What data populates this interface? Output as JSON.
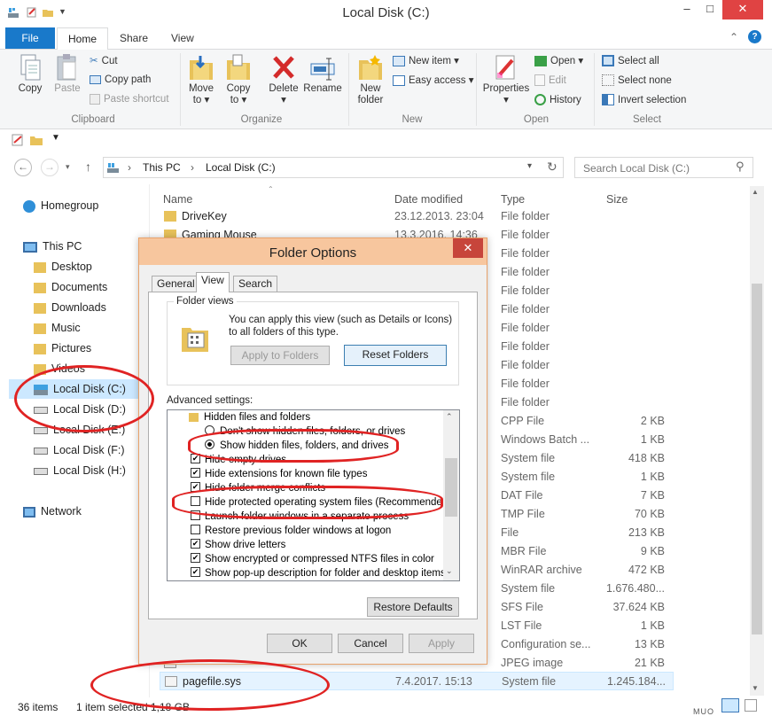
{
  "window": {
    "title": "Local Disk (C:)",
    "min": "‒",
    "max": "□",
    "close": "✕"
  },
  "ribbon": {
    "tabs": [
      "File",
      "Home",
      "Share",
      "View"
    ],
    "clipboard": {
      "label": "Clipboard",
      "copy": "Copy",
      "paste": "Paste",
      "cut": "Cut",
      "copy_path": "Copy path",
      "paste_shortcut": "Paste shortcut"
    },
    "organize": {
      "label": "Organize",
      "move_to": "Move",
      "move_to2": "to ▾",
      "copy_to": "Copy",
      "copy_to2": "to ▾",
      "delete": "Delete",
      "delete2": "▾",
      "rename": "Rename"
    },
    "new": {
      "label": "New",
      "new_folder": "New",
      "new_folder2": "folder",
      "new_item": "New item ▾",
      "easy_access": "Easy access ▾"
    },
    "open": {
      "label": "Open",
      "properties": "Properties",
      "properties2": "▾",
      "open": "Open ▾",
      "edit": "Edit",
      "history": "History"
    },
    "select": {
      "label": "Select",
      "select_all": "Select all",
      "select_none": "Select none",
      "invert": "Invert selection"
    }
  },
  "address": {
    "this_pc": "This PC",
    "drive": "Local Disk (C:)",
    "search_placeholder": "Search Local Disk (C:)"
  },
  "nav": {
    "homegroup": "Homegroup",
    "this_pc": "This PC",
    "desktop": "Desktop",
    "documents": "Documents",
    "downloads": "Downloads",
    "music": "Music",
    "pictures": "Pictures",
    "videos": "Videos",
    "drive_c": "Local Disk (C:)",
    "drive_d": "Local Disk (D:)",
    "drive_e": "Local Disk (E:)",
    "drive_f": "Local Disk (F:)",
    "drive_h": "Local Disk (H:)",
    "network": "Network"
  },
  "columns": {
    "name": "Name",
    "date": "Date modified",
    "type": "Type",
    "size": "Size"
  },
  "files": [
    {
      "name": "DriveKey",
      "date": "23.12.2013. 23:04",
      "type": "File folder",
      "size": ""
    },
    {
      "name": "Gaming Mouse",
      "date": "13.3.2016. 14:36",
      "type": "File folder",
      "size": ""
    },
    {
      "name": "",
      "date": "",
      "type": "File folder",
      "size": ""
    },
    {
      "name": "",
      "date": "",
      "type": "File folder",
      "size": ""
    },
    {
      "name": "",
      "date": "",
      "type": "File folder",
      "size": ""
    },
    {
      "name": "",
      "date": "",
      "type": "File folder",
      "size": ""
    },
    {
      "name": "",
      "date": "",
      "type": "File folder",
      "size": ""
    },
    {
      "name": "",
      "date": "",
      "type": "File folder",
      "size": ""
    },
    {
      "name": "",
      "date": "",
      "type": "File folder",
      "size": ""
    },
    {
      "name": "",
      "date": "",
      "type": "File folder",
      "size": ""
    },
    {
      "name": "",
      "date": "",
      "type": "File folder",
      "size": ""
    },
    {
      "name": "",
      "date": "",
      "type": "CPP File",
      "size": "2 KB"
    },
    {
      "name": "",
      "date": "",
      "type": "Windows Batch ...",
      "size": "1 KB"
    },
    {
      "name": "",
      "date": "",
      "type": "System file",
      "size": "418 KB"
    },
    {
      "name": "",
      "date": "",
      "type": "System file",
      "size": "1 KB"
    },
    {
      "name": "",
      "date": "",
      "type": "DAT File",
      "size": "7 KB"
    },
    {
      "name": "",
      "date": "",
      "type": "TMP File",
      "size": "70 KB"
    },
    {
      "name": "",
      "date": "",
      "type": "File",
      "size": "213 KB"
    },
    {
      "name": "",
      "date": "",
      "type": "MBR File",
      "size": "9 KB"
    },
    {
      "name": "",
      "date": "",
      "type": "WinRAR archive",
      "size": "472 KB"
    },
    {
      "name": "",
      "date": "",
      "type": "System file",
      "size": "1.676.480..."
    },
    {
      "name": "",
      "date": "",
      "type": "SFS File",
      "size": "37.624 KB"
    },
    {
      "name": "",
      "date": "",
      "type": "LST File",
      "size": "1 KB"
    },
    {
      "name": "",
      "date": "",
      "type": "Configuration se...",
      "size": "13 KB"
    },
    {
      "name": "",
      "date": "",
      "type": "JPEG image",
      "size": "21 KB"
    },
    {
      "name": "pagefile.sys",
      "date": "7.4.2017. 15:13",
      "type": "System file",
      "size": "1.245.184..."
    }
  ],
  "status": {
    "items": "36 items",
    "selected": "1 item selected",
    "size": "1,18 GB"
  },
  "watermark": "MUO",
  "dialog": {
    "title": "Folder Options",
    "close": "✕",
    "tabs": [
      "General",
      "View",
      "Search"
    ],
    "folder_views": {
      "label": "Folder views",
      "text": "You can apply this view (such as Details or Icons) to all folders of this type.",
      "apply": "Apply to Folders",
      "reset": "Reset Folders"
    },
    "advanced_label": "Advanced settings:",
    "advanced": [
      {
        "kind": "folder",
        "text": "Hidden files and folders"
      },
      {
        "kind": "radio",
        "checked": false,
        "text": "Don't show hidden files, folders, or drives"
      },
      {
        "kind": "radio",
        "checked": true,
        "text": "Show hidden files, folders, and drives"
      },
      {
        "kind": "check",
        "checked": true,
        "text": "Hide empty drives"
      },
      {
        "kind": "check",
        "checked": true,
        "text": "Hide extensions for known file types"
      },
      {
        "kind": "check",
        "checked": true,
        "text": "Hide folder merge conflicts"
      },
      {
        "kind": "check",
        "checked": false,
        "text": "Hide protected operating system files (Recommended)"
      },
      {
        "kind": "check",
        "checked": false,
        "text": "Launch folder windows in a separate process"
      },
      {
        "kind": "check",
        "checked": false,
        "text": "Restore previous folder windows at logon"
      },
      {
        "kind": "check",
        "checked": true,
        "text": "Show drive letters"
      },
      {
        "kind": "check",
        "checked": true,
        "text": "Show encrypted or compressed NTFS files in color"
      },
      {
        "kind": "check",
        "checked": true,
        "text": "Show pop-up description for folder and desktop items"
      }
    ],
    "restore_defaults": "Restore Defaults",
    "ok": "OK",
    "cancel": "Cancel",
    "apply": "Apply"
  }
}
